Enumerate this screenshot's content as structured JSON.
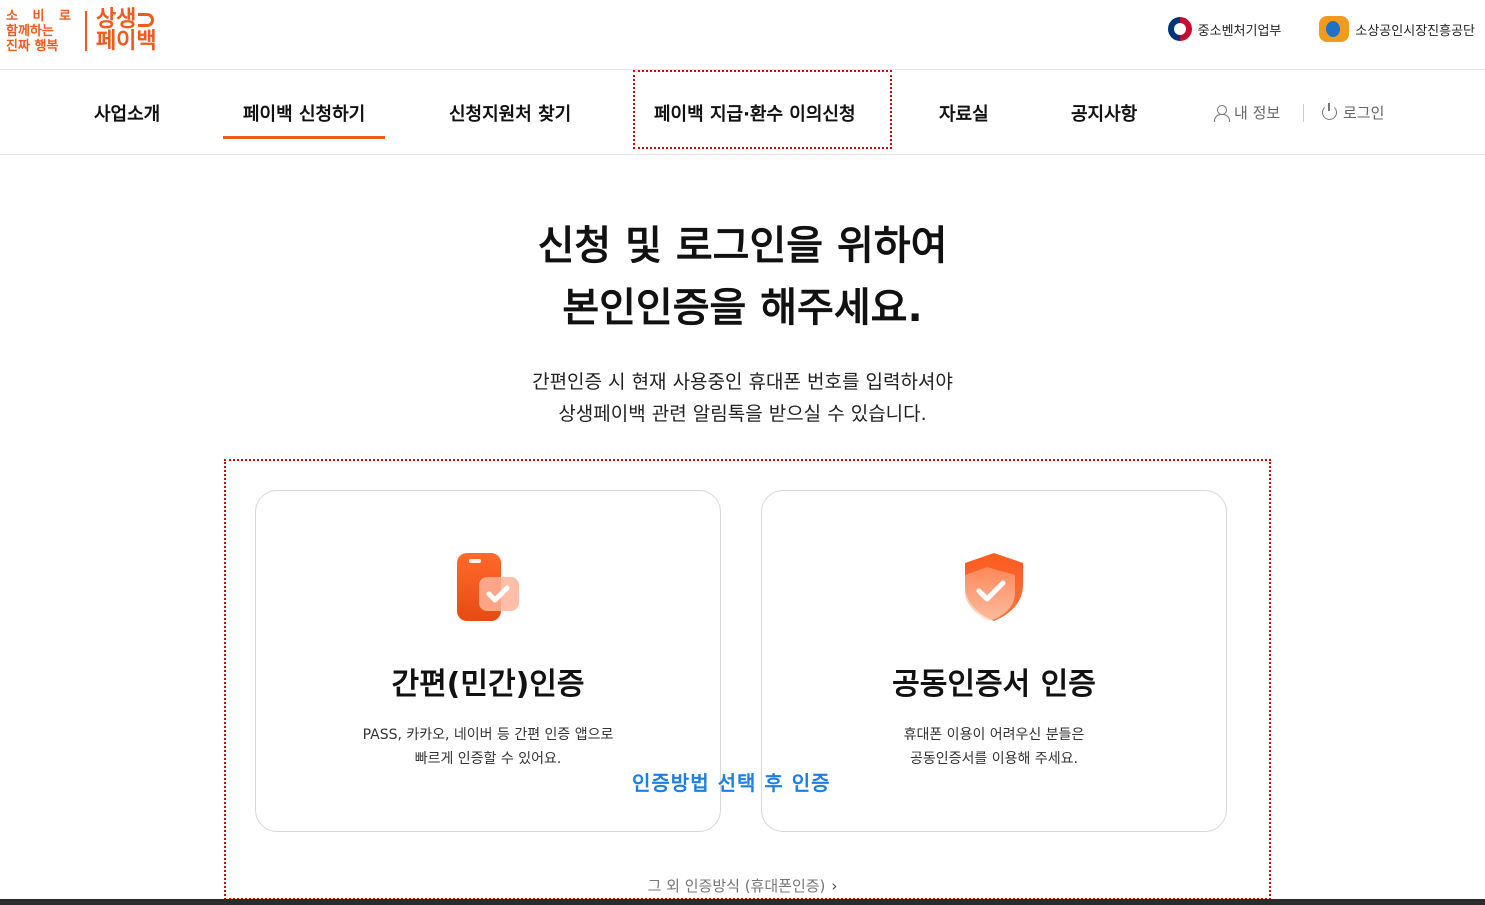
{
  "logo": {
    "slogan": [
      "소 비 로",
      "함께하는",
      "진짜 행복"
    ],
    "brand_top": "상생",
    "brand_bottom": "페이백"
  },
  "partners": [
    {
      "label": "중소벤처기업부",
      "icon": "government-emblem-icon"
    },
    {
      "label": "소상공인시장진흥공단",
      "icon": "semas-logo-icon"
    }
  ],
  "nav": {
    "items": [
      "사업소개",
      "페이백 신청하기",
      "신청지원처 찾기",
      "페이백 지급·환수 이의신청",
      "자료실",
      "공지사항"
    ],
    "active_index": 1,
    "my_info": "내 정보",
    "login": "로그인"
  },
  "hero": {
    "headline_line1": "신청 및 로그인을 위하여",
    "headline_line2": "본인인증을 해주세요.",
    "sub_line1": "간편인증 시 현재 사용중인 휴대폰 번호를 입력하셔야",
    "sub_line2": "상생페이백 관련 알림톡을 받으실 수 있습니다."
  },
  "auth_cards": [
    {
      "title": "간편(민간)인증",
      "desc_line1": "PASS, 카카오, 네이버 등 간편 인증 앱으로",
      "desc_line2": "빠르게 인증할 수 있어요.",
      "icon": "phone-check-icon"
    },
    {
      "title": "공동인증서 인증",
      "desc_line1": "휴대폰 이용이 어려우신 분들은",
      "desc_line2": "공동인증서를 이용해 주세요.",
      "icon": "shield-check-icon"
    }
  ],
  "overlay_label": "인증방법 선택 후 인증",
  "other_auth": "그 외 인증방식 (휴대폰인증)",
  "colors": {
    "accent": "#f25a1d",
    "annotation_red": "#d40000",
    "annotation_blue": "#1c7fe6"
  }
}
